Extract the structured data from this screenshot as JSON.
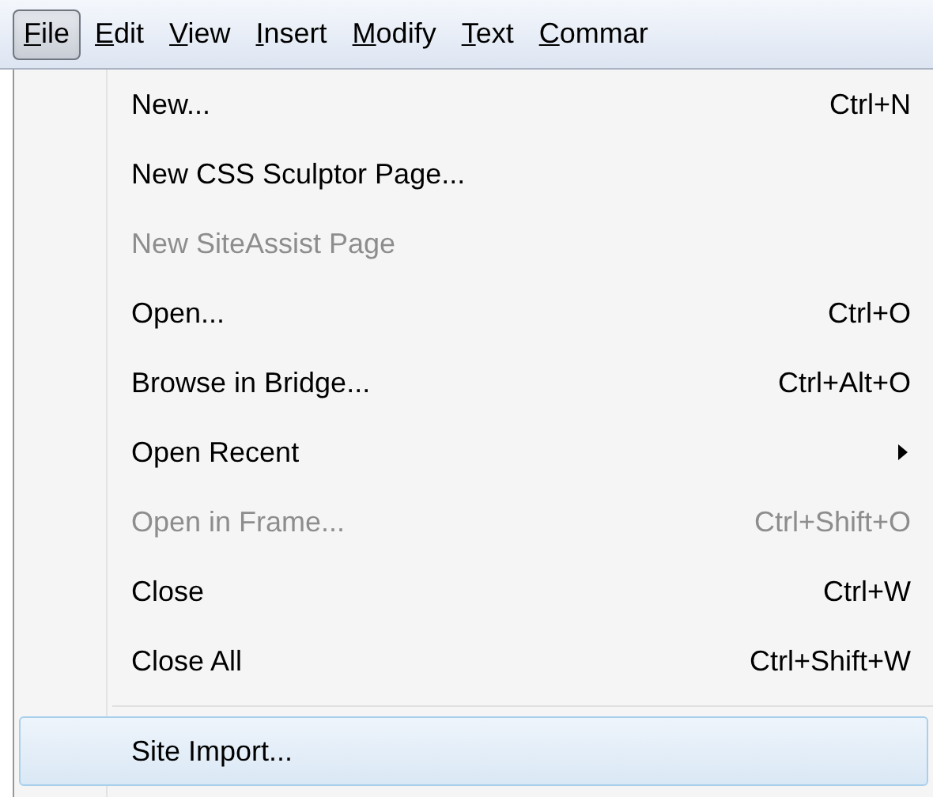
{
  "menu_bar": [
    {
      "label": "File",
      "selected": true
    },
    {
      "label": "Edit",
      "selected": false
    },
    {
      "label": "View",
      "selected": false
    },
    {
      "label": "Insert",
      "selected": false
    },
    {
      "label": "Modify",
      "selected": false
    },
    {
      "label": "Text",
      "selected": false
    },
    {
      "label": "Commar",
      "selected": false
    }
  ],
  "menu": [
    {
      "kind": "item",
      "label": "New...",
      "shortcut": "Ctrl+N",
      "disabled": false,
      "highlighted": false
    },
    {
      "kind": "item",
      "label": "New CSS Sculptor Page...",
      "disabled": false,
      "highlighted": false
    },
    {
      "kind": "item",
      "label": "New SiteAssist Page",
      "disabled": true,
      "highlighted": false
    },
    {
      "kind": "item",
      "label": "Open...",
      "shortcut": "Ctrl+O",
      "disabled": false,
      "highlighted": false
    },
    {
      "kind": "item",
      "label": "Browse in Bridge...",
      "shortcut": "Ctrl+Alt+O",
      "disabled": false,
      "highlighted": false
    },
    {
      "kind": "submenu",
      "label": "Open Recent",
      "disabled": false,
      "highlighted": false
    },
    {
      "kind": "item",
      "label": "Open in Frame...",
      "shortcut": "Ctrl+Shift+O",
      "disabled": true,
      "highlighted": false
    },
    {
      "kind": "item",
      "label": "Close",
      "shortcut": "Ctrl+W",
      "disabled": false,
      "highlighted": false
    },
    {
      "kind": "item",
      "label": "Close All",
      "shortcut": "Ctrl+Shift+W",
      "disabled": false,
      "highlighted": false
    },
    {
      "kind": "separator"
    },
    {
      "kind": "item",
      "label": "Site Import...",
      "disabled": false,
      "highlighted": true
    }
  ]
}
